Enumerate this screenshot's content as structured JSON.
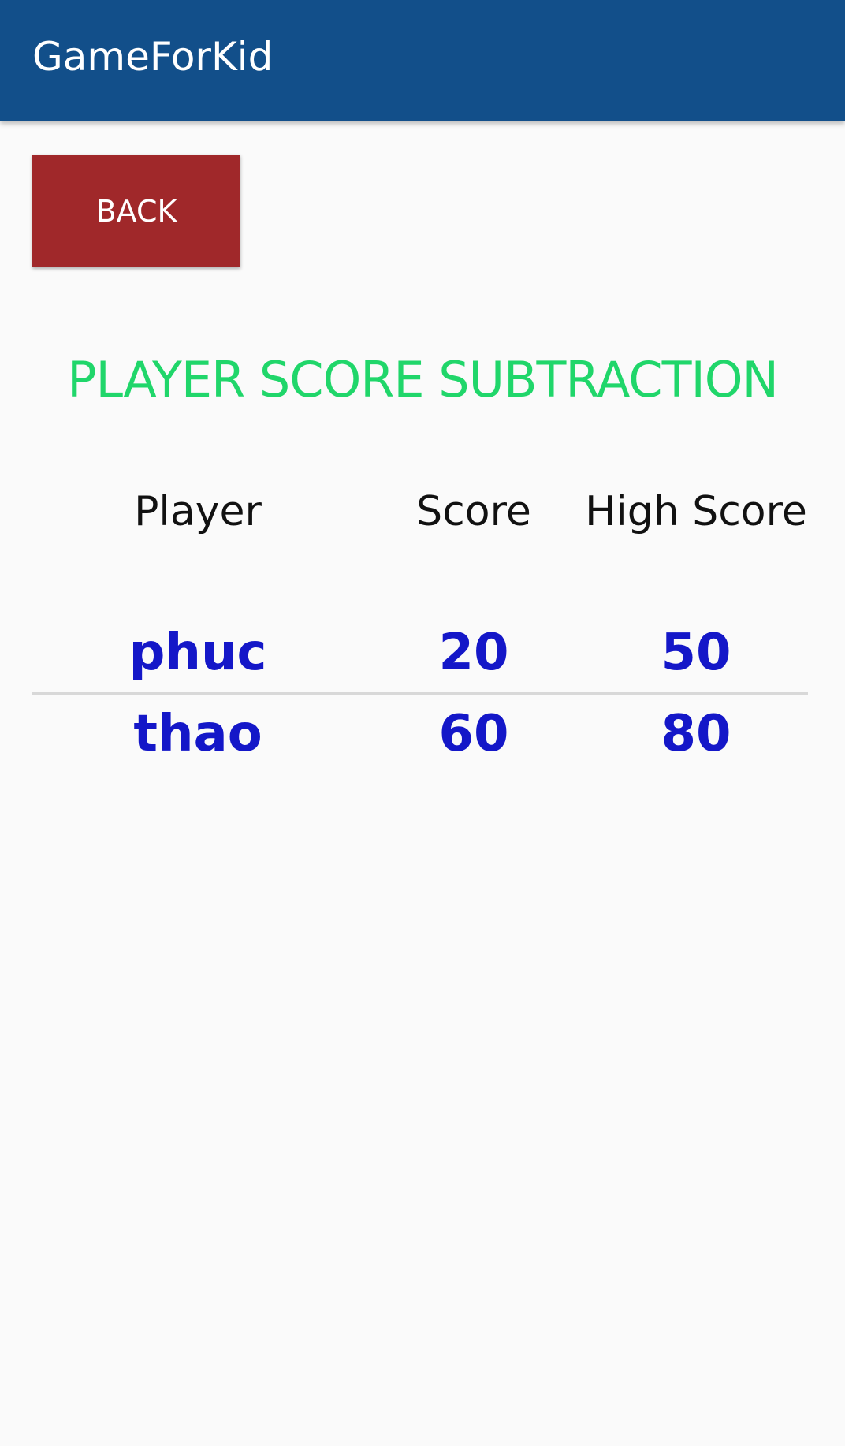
{
  "app_bar": {
    "title": "GameForKid",
    "color": "#124f8a"
  },
  "back_button": {
    "label": "BACK",
    "color": "#a0282a"
  },
  "screen_title": "PLAYER SCORE SUBTRACTION",
  "table": {
    "headers": [
      "Player",
      "Score",
      "High Score"
    ],
    "rows": [
      {
        "player": "phuc",
        "score": "20",
        "high_score": "50"
      },
      {
        "player": "thao",
        "score": "60",
        "high_score": "80"
      }
    ]
  },
  "colors": {
    "title": "#20d66a",
    "values": "#1417c8",
    "headers": "#111111"
  }
}
